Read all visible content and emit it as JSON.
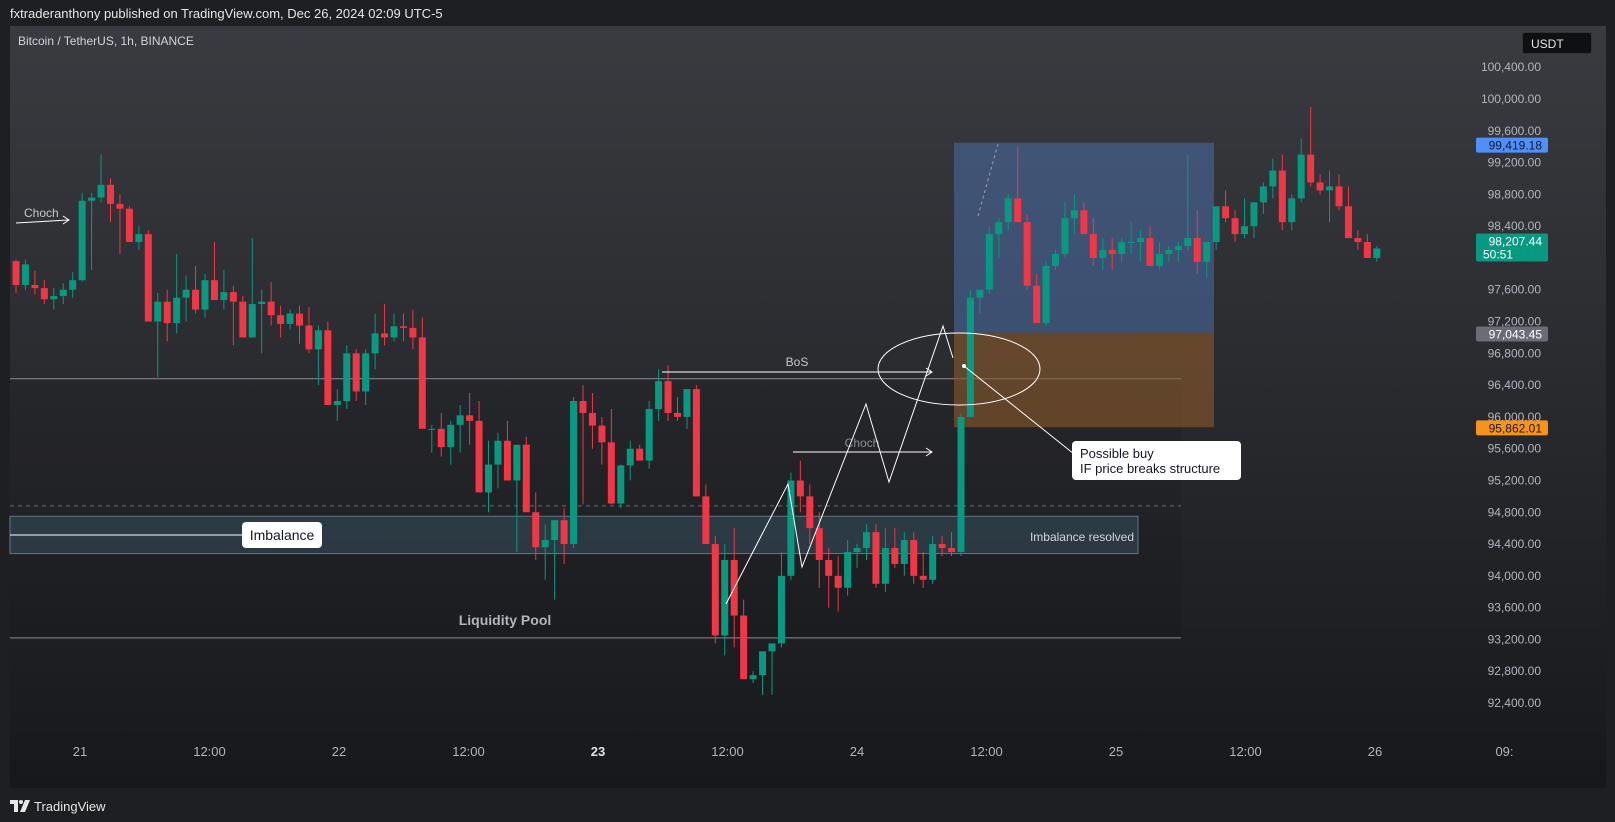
{
  "header": {
    "text": "fxtraderanthony published on TradingView.com, Dec 26, 2024 02:09 UTC-5"
  },
  "symbol": {
    "title": "Bitcoin / TetherUS, 1h, BINANCE"
  },
  "currency": "USDT",
  "footer": {
    "brand": "TradingView",
    "logo_icon": "tradingview-logo-icon"
  },
  "colors": {
    "up": "#089981",
    "down": "#f23645",
    "axis_text": "#b2b5be",
    "buy_zone": "#4b6ea8",
    "entry_zone": "#8a5a2a",
    "imbalance_zone": "#3d5566"
  },
  "price_badges": [
    {
      "text": "99,419.18",
      "bg": "#4f8ff7",
      "fg": "#0b1a33"
    },
    {
      "text": "98,207.44",
      "sub": "50:51",
      "bg": "#089981",
      "fg": "#ffffff"
    },
    {
      "text": "97,043.45",
      "bg": "#6a6d78",
      "fg": "#ffffff"
    },
    {
      "text": "95,862.01",
      "bg": "#f7931a",
      "fg": "#1a1a1a"
    }
  ],
  "annotations": {
    "choch_left": "Choch",
    "bos": "BoS",
    "choch_mid": "Choch",
    "imbalance": "Imbalance",
    "imbalance_resolved": "Imbalance resolved",
    "liquidity_pool": "Liquidity Pool",
    "possible_buy_line1": "Possible buy",
    "possible_buy_line2": "IF price breaks structure"
  },
  "chart_data": {
    "type": "candlestick",
    "symbol": "Bitcoin / TetherUS",
    "interval": "1h",
    "exchange": "BINANCE",
    "y_ticks": [
      "100,400.00",
      "100,000.00",
      "99,600.00",
      "99,200.00",
      "98,800.00",
      "98,400.00",
      "97,600.00",
      "97,200.00",
      "96,800.00",
      "96,400.00",
      "96,000.00",
      "95,600.00",
      "95,200.00",
      "94,800.00",
      "94,400.00",
      "94,000.00",
      "93,600.00",
      "93,200.00",
      "92,800.00",
      "92,400.00"
    ],
    "ylim": [
      92000,
      100800
    ],
    "x_ticks": [
      {
        "label": "21",
        "bold": false
      },
      {
        "label": "12:00",
        "bold": false
      },
      {
        "label": "22",
        "bold": false
      },
      {
        "label": "12:00",
        "bold": false
      },
      {
        "label": "23",
        "bold": true
      },
      {
        "label": "12:00",
        "bold": false
      },
      {
        "label": "24",
        "bold": false
      },
      {
        "label": "12:00",
        "bold": false
      },
      {
        "label": "25",
        "bold": false
      },
      {
        "label": "12:00",
        "bold": false
      },
      {
        "label": "26",
        "bold": false
      },
      {
        "label": "09:",
        "bold": false
      }
    ],
    "candles": [
      [
        97960,
        97980,
        97560,
        97660
      ],
      [
        97660,
        97980,
        97600,
        97920
      ],
      [
        97660,
        97840,
        97540,
        97620
      ],
      [
        97620,
        97720,
        97420,
        97480
      ],
      [
        97480,
        97620,
        97350,
        97520
      ],
      [
        97520,
        97680,
        97420,
        97600
      ],
      [
        97600,
        97820,
        97500,
        97720
      ],
      [
        97720,
        98820,
        97700,
        98720
      ],
      [
        98720,
        98820,
        97850,
        98760
      ],
      [
        98760,
        99300,
        98700,
        98920
      ],
      [
        98920,
        99000,
        98450,
        98680
      ],
      [
        98680,
        98800,
        98050,
        98620
      ],
      [
        98620,
        98650,
        98200,
        98200
      ],
      [
        98200,
        98400,
        98100,
        98300
      ],
      [
        98300,
        98350,
        97200,
        97200
      ],
      [
        97200,
        97560,
        96500,
        97450
      ],
      [
        97450,
        97600,
        96950,
        97180
      ],
      [
        97180,
        98050,
        97050,
        97500
      ],
      [
        97500,
        97780,
        97200,
        97600
      ],
      [
        97600,
        97900,
        97300,
        97350
      ],
      [
        97350,
        97800,
        97250,
        97720
      ],
      [
        97720,
        98200,
        97500,
        97470
      ],
      [
        97470,
        97850,
        97350,
        97570
      ],
      [
        97570,
        97650,
        96900,
        97450
      ],
      [
        97450,
        97520,
        97000,
        97000
      ],
      [
        97000,
        98250,
        97000,
        97420
      ],
      [
        97420,
        97600,
        96800,
        97450
      ],
      [
        97450,
        97700,
        97150,
        97280
      ],
      [
        97280,
        97400,
        97000,
        97170
      ],
      [
        97170,
        97350,
        97100,
        97300
      ],
      [
        97300,
        97400,
        96920,
        97150
      ],
      [
        97150,
        97380,
        96800,
        96850
      ],
      [
        96850,
        97150,
        96400,
        97090
      ],
      [
        97090,
        97200,
        96300,
        96150
      ],
      [
        96150,
        96350,
        95950,
        96200
      ],
      [
        96200,
        96900,
        96100,
        96800
      ],
      [
        96800,
        96850,
        96200,
        96320
      ],
      [
        96320,
        96850,
        96150,
        96800
      ],
      [
        96800,
        97300,
        96600,
        97050
      ],
      [
        97050,
        97420,
        96900,
        97000
      ],
      [
        97000,
        97300,
        96950,
        97140
      ],
      [
        97140,
        97300,
        96950,
        97120
      ],
      [
        97120,
        97350,
        96850,
        97000
      ],
      [
        97000,
        97250,
        96800,
        95850
      ],
      [
        95850,
        95900,
        95550,
        95850
      ],
      [
        95850,
        96050,
        95500,
        95620
      ],
      [
        95620,
        95950,
        95400,
        95900
      ],
      [
        95900,
        96150,
        95550,
        96020
      ],
      [
        96020,
        96300,
        95650,
        95950
      ],
      [
        95950,
        96200,
        95250,
        95050
      ],
      [
        95050,
        95700,
        94800,
        95400
      ],
      [
        95400,
        95800,
        95100,
        95700
      ],
      [
        95700,
        95950,
        95300,
        95200
      ],
      [
        95200,
        95620,
        94300,
        95650
      ],
      [
        95650,
        95750,
        94900,
        94800
      ],
      [
        94800,
        95050,
        94200,
        94360
      ],
      [
        94360,
        94650,
        93950,
        94450
      ],
      [
        94450,
        94600,
        93700,
        94700
      ],
      [
        94700,
        94850,
        94150,
        94400
      ],
      [
        94400,
        96250,
        94350,
        96200
      ],
      [
        96200,
        96400,
        94900,
        96050
      ],
      [
        96050,
        96300,
        95600,
        95890
      ],
      [
        95890,
        96000,
        95400,
        95680
      ],
      [
        95680,
        96100,
        94900,
        94910
      ],
      [
        94910,
        95400,
        94850,
        95390
      ],
      [
        95390,
        95700,
        95200,
        95600
      ],
      [
        95600,
        95650,
        95500,
        95450
      ],
      [
        95450,
        96200,
        95350,
        96100
      ],
      [
        96100,
        96600,
        95950,
        96450
      ],
      [
        96450,
        96650,
        95950,
        96050
      ],
      [
        96050,
        96250,
        95950,
        96000
      ],
      [
        96000,
        96100,
        95850,
        96350
      ],
      [
        96350,
        96400,
        95000,
        95000
      ],
      [
        95000,
        95150,
        94800,
        94400
      ],
      [
        94400,
        94500,
        93150,
        93250
      ],
      [
        93250,
        94400,
        93000,
        94200
      ],
      [
        94200,
        94600,
        93100,
        93500
      ],
      [
        93500,
        93700,
        92700,
        92700
      ],
      [
        92700,
        92800,
        92650,
        92750
      ],
      [
        92750,
        93000,
        92500,
        93050
      ],
      [
        93050,
        93100,
        92500,
        93150
      ],
      [
        93150,
        94300,
        93100,
        94000
      ],
      [
        94000,
        95300,
        93950,
        95200
      ],
      [
        95200,
        95450,
        94800,
        95000
      ],
      [
        95000,
        95150,
        94400,
        94600
      ],
      [
        94600,
        94800,
        93850,
        94200
      ],
      [
        94200,
        94350,
        93600,
        94000
      ],
      [
        94000,
        94250,
        93550,
        93850
      ],
      [
        93850,
        94450,
        93750,
        94300
      ],
      [
        94300,
        94400,
        94100,
        94350
      ],
      [
        94350,
        94650,
        94200,
        94550
      ],
      [
        94550,
        94650,
        93850,
        93900
      ],
      [
        93900,
        94600,
        93800,
        94350
      ],
      [
        94350,
        94600,
        94100,
        94150
      ],
      [
        94150,
        94550,
        94000,
        94450
      ],
      [
        94450,
        94550,
        93900,
        94000
      ],
      [
        94000,
        94300,
        93850,
        93950
      ],
      [
        93950,
        94500,
        93900,
        94400
      ],
      [
        94400,
        94500,
        94250,
        94350
      ],
      [
        94350,
        94550,
        94250,
        94300
      ],
      [
        94300,
        96050,
        94250,
        96000
      ],
      [
        96000,
        97600,
        96000,
        97500
      ],
      [
        97500,
        97550,
        97300,
        97600
      ],
      [
        97600,
        98400,
        97550,
        98300
      ],
      [
        98300,
        98500,
        98000,
        98450
      ],
      [
        98450,
        98800,
        98350,
        98750
      ],
      [
        98750,
        99400,
        98550,
        98450
      ],
      [
        98450,
        98550,
        97600,
        97650
      ],
      [
        97650,
        97800,
        97200,
        97180
      ],
      [
        97180,
        97950,
        97150,
        97900
      ],
      [
        97900,
        98100,
        97850,
        98050
      ],
      [
        98050,
        98700,
        98000,
        98500
      ],
      [
        98500,
        98800,
        98300,
        98600
      ],
      [
        98600,
        98700,
        98400,
        98300
      ],
      [
        98300,
        98500,
        97900,
        98000
      ],
      [
        98000,
        98250,
        97850,
        98100
      ],
      [
        98100,
        98250,
        97850,
        98050
      ],
      [
        98050,
        98250,
        97950,
        98200
      ],
      [
        98200,
        98450,
        98050,
        98200
      ],
      [
        98200,
        98350,
        97950,
        98250
      ],
      [
        98250,
        98400,
        97900,
        97900
      ],
      [
        97900,
        98200,
        97850,
        98050
      ],
      [
        98050,
        98150,
        97950,
        98100
      ],
      [
        98100,
        98200,
        97950,
        98150
      ],
      [
        98150,
        99300,
        98100,
        98250
      ],
      [
        98250,
        98600,
        97800,
        97950
      ],
      [
        97950,
        98200,
        97750,
        98200
      ],
      [
        98200,
        98650,
        98100,
        98650
      ],
      [
        98650,
        98850,
        98450,
        98500
      ],
      [
        98500,
        98600,
        98200,
        98300
      ],
      [
        98300,
        98750,
        98250,
        98400
      ],
      [
        98400,
        98700,
        98250,
        98700
      ],
      [
        98700,
        98950,
        98550,
        98900
      ],
      [
        98900,
        99250,
        98750,
        99100
      ],
      [
        99100,
        99300,
        98350,
        98450
      ],
      [
        98450,
        98800,
        98350,
        98750
      ],
      [
        98750,
        99500,
        98700,
        99300
      ],
      [
        99300,
        99900,
        98900,
        98950
      ],
      [
        98950,
        99050,
        98800,
        98850
      ],
      [
        98850,
        99100,
        98450,
        98900
      ],
      [
        98900,
        99050,
        98600,
        98650
      ],
      [
        98650,
        98900,
        98250,
        98250
      ],
      [
        98250,
        98350,
        98100,
        98200
      ],
      [
        98200,
        98300,
        98000,
        98000
      ],
      [
        98000,
        98150,
        97950,
        98120
      ]
    ]
  }
}
